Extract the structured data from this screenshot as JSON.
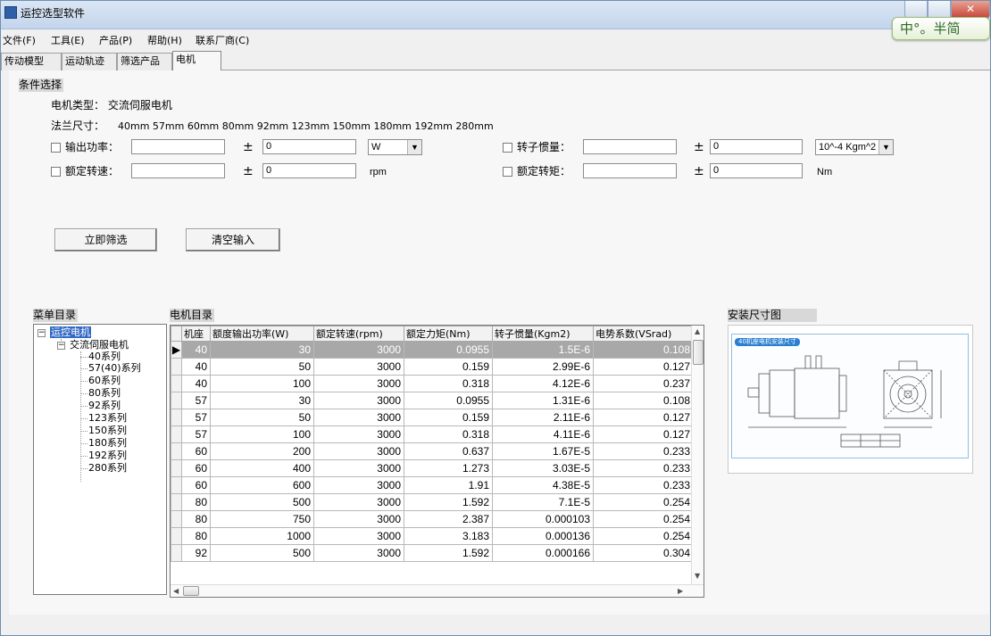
{
  "window": {
    "title": "运控选型软件"
  },
  "ime_badge": "中°。半简",
  "menu": [
    {
      "label": "文件(F)"
    },
    {
      "label": "工具(E)"
    },
    {
      "label": "产品(P)"
    },
    {
      "label": "帮助(H)"
    },
    {
      "label": "联系厂商(C)"
    }
  ],
  "tabs": [
    {
      "label": "传动模型"
    },
    {
      "label": "运动轨迹"
    },
    {
      "label": "筛选产品"
    },
    {
      "label": "电机"
    }
  ],
  "conditions": {
    "section_title": "条件选择",
    "motor_type": "电机类型：  交流伺服电机",
    "flange_label": "法兰尺寸：",
    "flange_sizes": "40mm   57mm   60mm   80mm   92mm   123mm  150mm  180mm  192mm  280mm",
    "pm": "±",
    "output_power": {
      "label": "输出功率：",
      "value": "",
      "tolerance": "0",
      "unit": "W"
    },
    "rated_speed": {
      "label": "额定转速：",
      "value": "",
      "tolerance": "0",
      "unit": "rpm"
    },
    "rotor_inertia": {
      "label": "转子惯量：",
      "value": "",
      "tolerance": "0",
      "unit": "10^-4 Kgm^2"
    },
    "rated_torque": {
      "label": "额定转矩：",
      "value": "",
      "tolerance": "0",
      "unit": "Nm"
    },
    "filter_button": "立即筛选",
    "clear_button": "清空输入"
  },
  "menu_tree": {
    "title": "菜单目录",
    "root": "运控电机",
    "child": "交流伺服电机",
    "series": [
      "40系列",
      "57(40)系列",
      "60系列",
      "80系列",
      "92系列",
      "123系列",
      "150系列",
      "180系列",
      "192系列",
      "280系列"
    ]
  },
  "motor_table": {
    "title": "电机目录",
    "columns": [
      "机座",
      "额度输出功率(W)",
      "额定转速(rpm)",
      "额定力矩(Nm)",
      "转子惯量(Kgm2)",
      "电势系数(VSrad)"
    ],
    "rows": [
      [
        "40",
        "30",
        "3000",
        "0.0955",
        "1.5E-6",
        "0.108"
      ],
      [
        "40",
        "50",
        "3000",
        "0.159",
        "2.99E-6",
        "0.127"
      ],
      [
        "40",
        "100",
        "3000",
        "0.318",
        "4.12E-6",
        "0.237"
      ],
      [
        "57",
        "30",
        "3000",
        "0.0955",
        "1.31E-6",
        "0.108"
      ],
      [
        "57",
        "50",
        "3000",
        "0.159",
        "2.11E-6",
        "0.127"
      ],
      [
        "57",
        "100",
        "3000",
        "0.318",
        "4.11E-6",
        "0.127"
      ],
      [
        "60",
        "200",
        "3000",
        "0.637",
        "1.67E-5",
        "0.233"
      ],
      [
        "60",
        "400",
        "3000",
        "1.273",
        "3.03E-5",
        "0.233"
      ],
      [
        "60",
        "600",
        "3000",
        "1.91",
        "4.38E-5",
        "0.233"
      ],
      [
        "80",
        "500",
        "3000",
        "1.592",
        "7.1E-5",
        "0.254"
      ],
      [
        "80",
        "750",
        "3000",
        "2.387",
        "0.000103",
        "0.254"
      ],
      [
        "80",
        "1000",
        "3000",
        "3.183",
        "0.000136",
        "0.254"
      ],
      [
        "92",
        "500",
        "3000",
        "1.592",
        "0.000166",
        "0.304"
      ]
    ]
  },
  "install_diagram": {
    "title": "安装尺寸图",
    "tag": "40机座电机安装尺寸"
  },
  "colors": {
    "selection": "#3169c6",
    "row_selected": "#a8a8a8"
  }
}
